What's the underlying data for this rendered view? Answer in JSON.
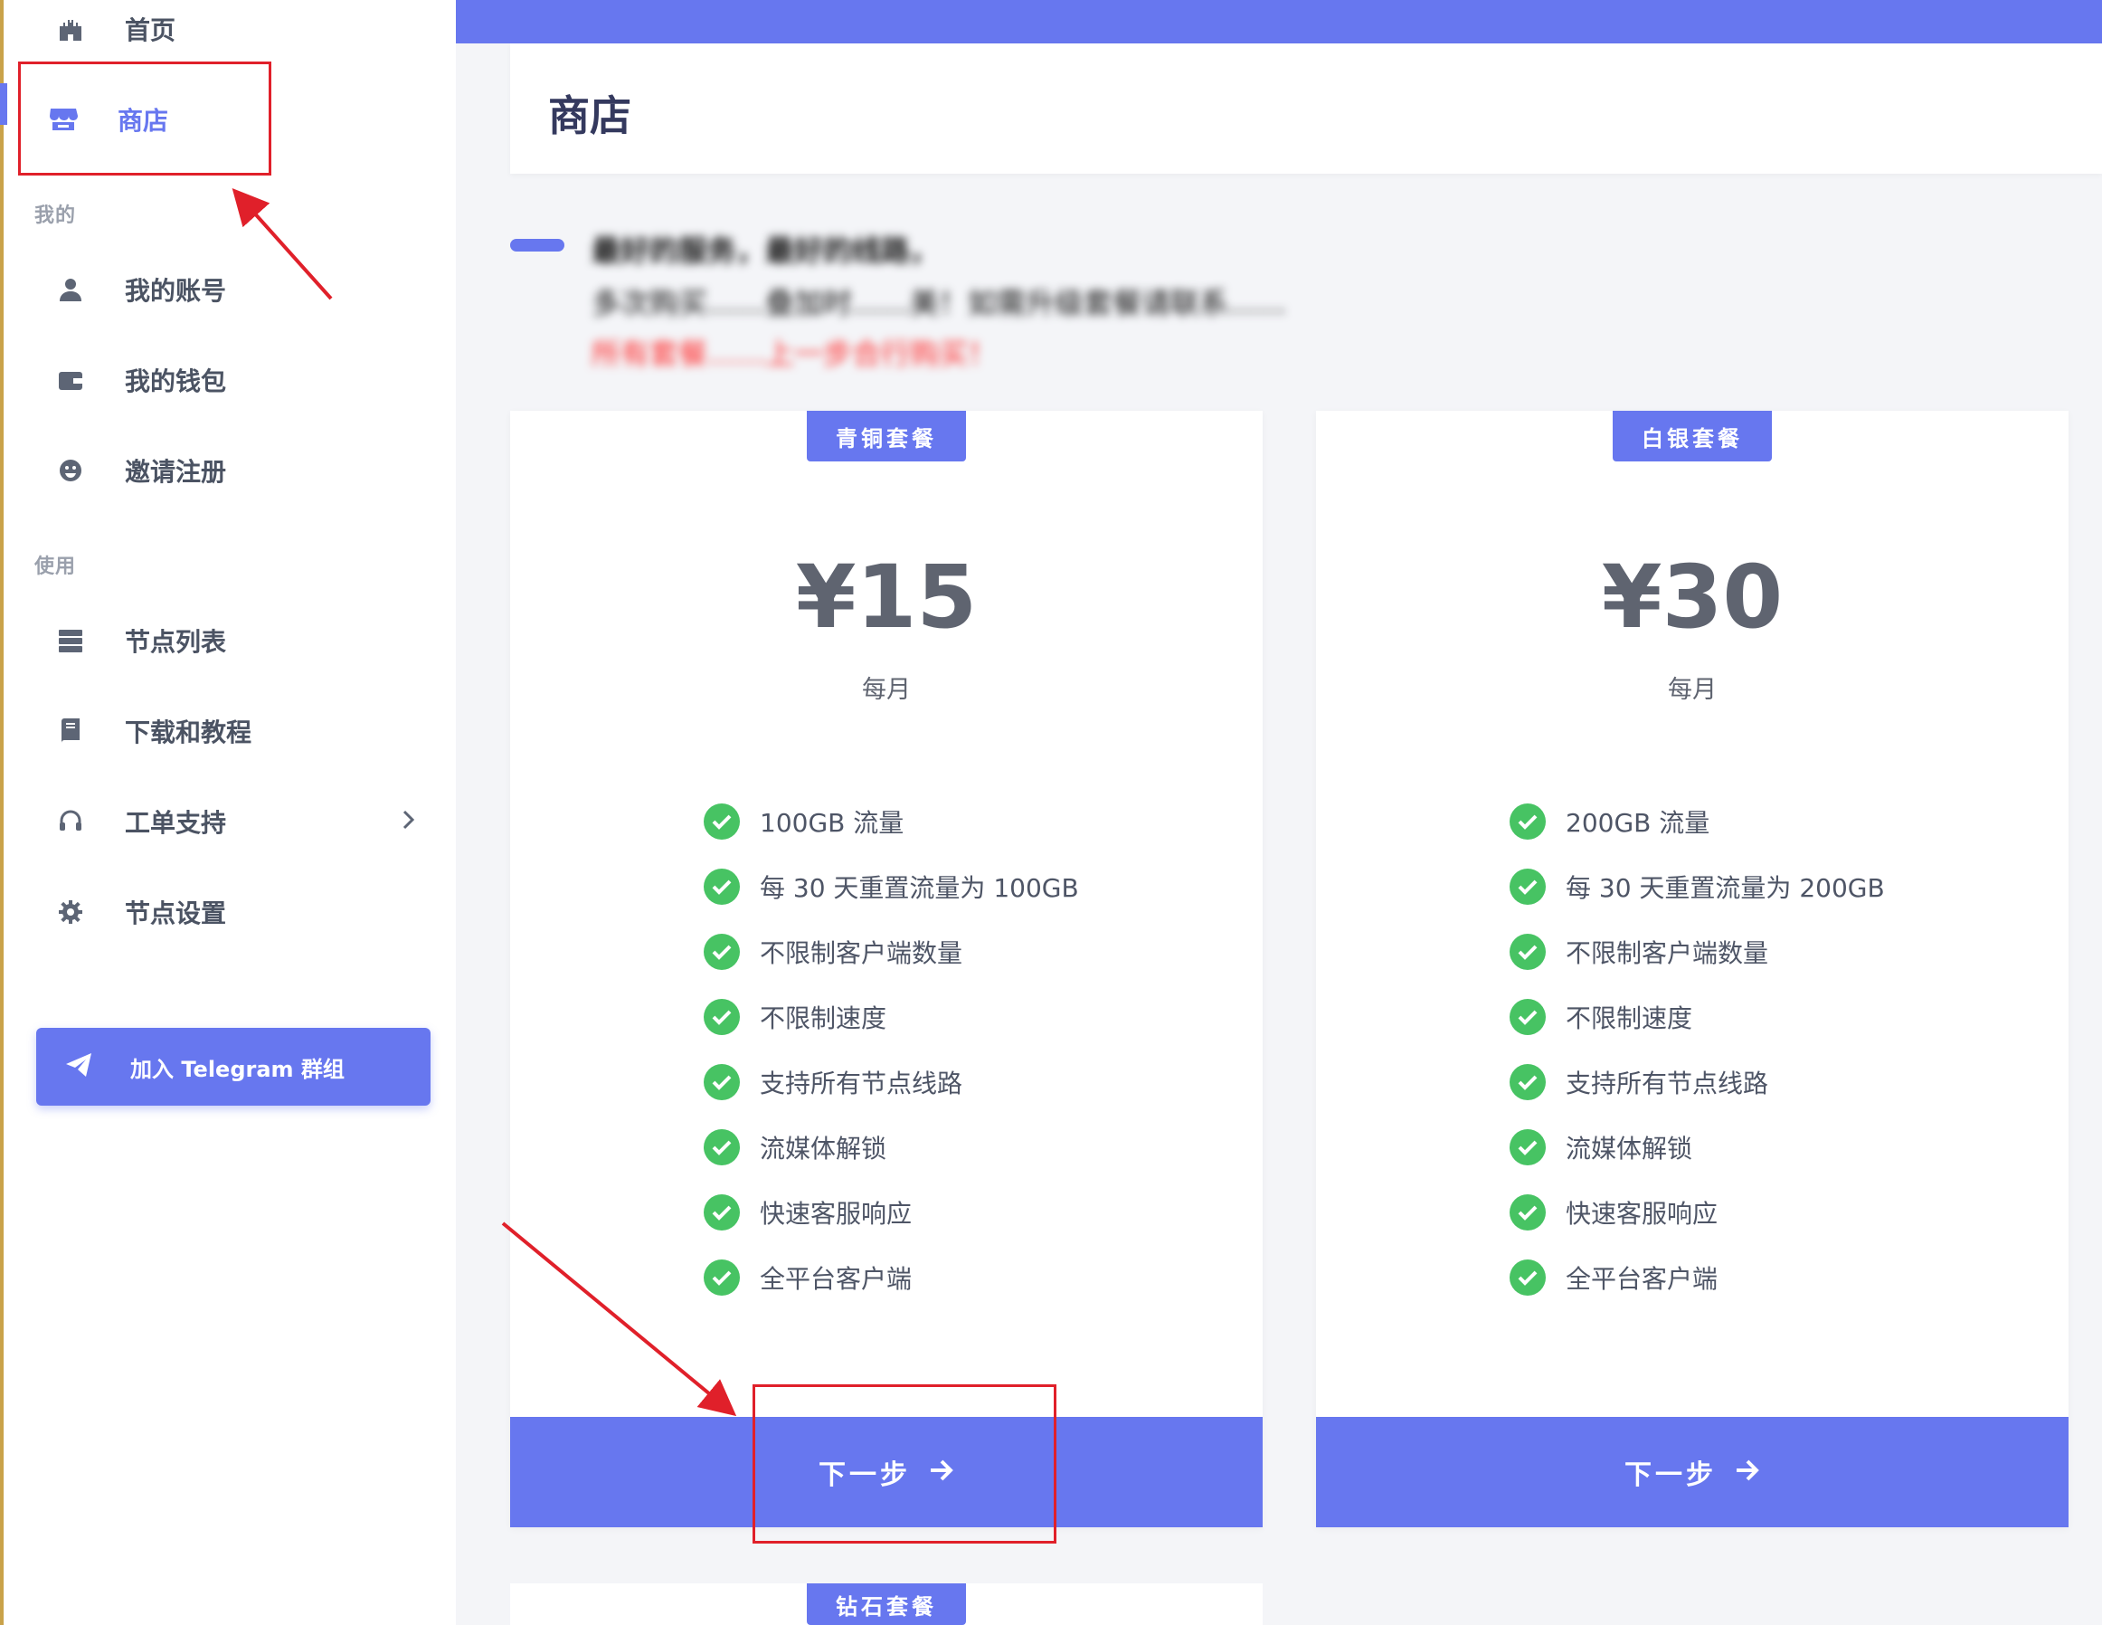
{
  "sidebar": {
    "home": {
      "label": "首页",
      "icon": "castle-icon"
    },
    "shop": {
      "label": "商店",
      "icon": "store-icon"
    },
    "section_mine": "我的",
    "account": {
      "label": "我的账号",
      "icon": "user-icon"
    },
    "wallet": {
      "label": "我的钱包",
      "icon": "wallet-icon"
    },
    "invite": {
      "label": "邀请注册",
      "icon": "smile-icon"
    },
    "section_use": "使用",
    "nodes": {
      "label": "节点列表",
      "icon": "server-icon"
    },
    "downloads": {
      "label": "下载和教程",
      "icon": "book-icon"
    },
    "tickets": {
      "label": "工单支持",
      "icon": "headset-icon"
    },
    "node_settings": {
      "label": "节点设置",
      "icon": "gear-icon"
    },
    "telegram_button": {
      "label": "加入 Telegram 群组",
      "icon": "paper-plane-icon"
    }
  },
  "page": {
    "title": "商店"
  },
  "notice": {
    "line1": "最好的服务，最好的线路，",
    "line2": "多次购买……叠加时……美！如需升级套餐请联系……",
    "line3": "所有套餐……上一步合行购买！"
  },
  "plans": [
    {
      "badge": "青铜套餐",
      "price": "¥15",
      "period": "每月",
      "features": [
        "100GB 流量",
        "每 30 天重置流量为 100GB",
        "不限制客户端数量",
        "不限制速度",
        "支持所有节点线路",
        "流媒体解锁",
        "快速客服响应",
        "全平台客户端"
      ],
      "button": "下一步"
    },
    {
      "badge": "白银套餐",
      "price": "¥30",
      "period": "每月",
      "features": [
        "200GB 流量",
        "每 30 天重置流量为 200GB",
        "不限制客户端数量",
        "不限制速度",
        "支持所有节点线路",
        "流媒体解锁",
        "快速客服响应",
        "全平台客户端"
      ],
      "button": "下一步"
    },
    {
      "badge": "钻石套餐"
    }
  ],
  "colors": {
    "accent": "#6777ef",
    "check": "#47c363",
    "annotation": "#e0202a",
    "notice_red": "#ff2b2b"
  }
}
